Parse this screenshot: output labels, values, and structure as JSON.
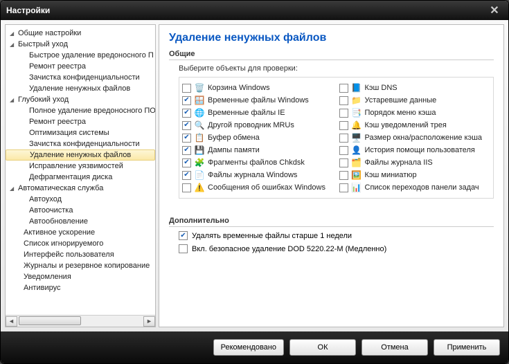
{
  "window": {
    "title": "Настройки"
  },
  "sidebar": {
    "items": [
      {
        "label": "Общие настройки",
        "type": "parent"
      },
      {
        "label": "Быстрый уход",
        "type": "parent"
      },
      {
        "label": "Быстрое удаление вредоносного П",
        "type": "child"
      },
      {
        "label": "Ремонт реестра",
        "type": "child"
      },
      {
        "label": "Зачистка конфиденциальности",
        "type": "child"
      },
      {
        "label": "Удаление ненужных файлов",
        "type": "child"
      },
      {
        "label": "Глубокий уход",
        "type": "parent"
      },
      {
        "label": "Полное удаление вредоносного ПО",
        "type": "child"
      },
      {
        "label": "Ремонт реестра",
        "type": "child"
      },
      {
        "label": "Оптимизация системы",
        "type": "child"
      },
      {
        "label": "Зачистка конфиденциальности",
        "type": "child"
      },
      {
        "label": "Удаление ненужных файлов",
        "type": "child",
        "selected": true
      },
      {
        "label": "Исправление уязвимостей",
        "type": "child"
      },
      {
        "label": "Дефрагментация диска",
        "type": "child"
      },
      {
        "label": "Автоматическая служба",
        "type": "parent"
      },
      {
        "label": "Автоуход",
        "type": "child"
      },
      {
        "label": "Автоочистка",
        "type": "child"
      },
      {
        "label": "Автообновление",
        "type": "child"
      },
      {
        "label": "Активное ускорение",
        "type": "item"
      },
      {
        "label": "Список игнорируемого",
        "type": "item"
      },
      {
        "label": "Интерфейс пользователя",
        "type": "item"
      },
      {
        "label": "Журналы и резервное копирование",
        "type": "item"
      },
      {
        "label": "Уведомления",
        "type": "item"
      },
      {
        "label": "Антивирус",
        "type": "item"
      }
    ]
  },
  "page": {
    "title": "Удаление ненужных файлов",
    "section_general": "Общие",
    "hint": "Выберите  объекты для проверки:",
    "section_additional": "Дополнительно"
  },
  "options_left": [
    {
      "checked": false,
      "icon": "🗑️",
      "label": "Корзина Windows"
    },
    {
      "checked": true,
      "icon": "🪟",
      "label": "Временные файлы Windows"
    },
    {
      "checked": true,
      "icon": "🌐",
      "label": "Временные файлы IE"
    },
    {
      "checked": true,
      "icon": "🔍",
      "label": "Другой проводник MRUs"
    },
    {
      "checked": true,
      "icon": "📋",
      "label": "Буфер обмена"
    },
    {
      "checked": true,
      "icon": "💾",
      "label": "Дампы памяти"
    },
    {
      "checked": true,
      "icon": "🧩",
      "label": "Фрагменты файлов Chkdsk"
    },
    {
      "checked": true,
      "icon": "📄",
      "label": "Файлы журнала Windows"
    },
    {
      "checked": false,
      "icon": "⚠️",
      "label": "Сообщения об ошибках Windows"
    }
  ],
  "options_right": [
    {
      "checked": false,
      "icon": "📘",
      "label": "Кэш DNS"
    },
    {
      "checked": false,
      "icon": "📁",
      "label": "Устаревшие данные"
    },
    {
      "checked": false,
      "icon": "📑",
      "label": "Порядок меню кэша"
    },
    {
      "checked": false,
      "icon": "🔔",
      "label": "Кэш уведомлений трея"
    },
    {
      "checked": false,
      "icon": "🖥️",
      "label": "Размер окна/расположение кэша"
    },
    {
      "checked": false,
      "icon": "👤",
      "label": "История помощи пользователя"
    },
    {
      "checked": false,
      "icon": "🗂️",
      "label": "Файлы журнала IIS"
    },
    {
      "checked": false,
      "icon": "🖼️",
      "label": "Кэш миниатюр"
    },
    {
      "checked": false,
      "icon": "📊",
      "label": "Список переходов панели задач"
    }
  ],
  "additional": {
    "opt1": {
      "checked": true,
      "label": "Удалять временные файлы  старше 1 недели"
    },
    "opt2": {
      "checked": false,
      "label": "Вкл. безопасное удаление DOD 5220.22-M (Медленно)"
    }
  },
  "buttons": {
    "recommended": "Рекомендовано",
    "ok": "ОК",
    "cancel": "Отмена",
    "apply": "Применить"
  }
}
